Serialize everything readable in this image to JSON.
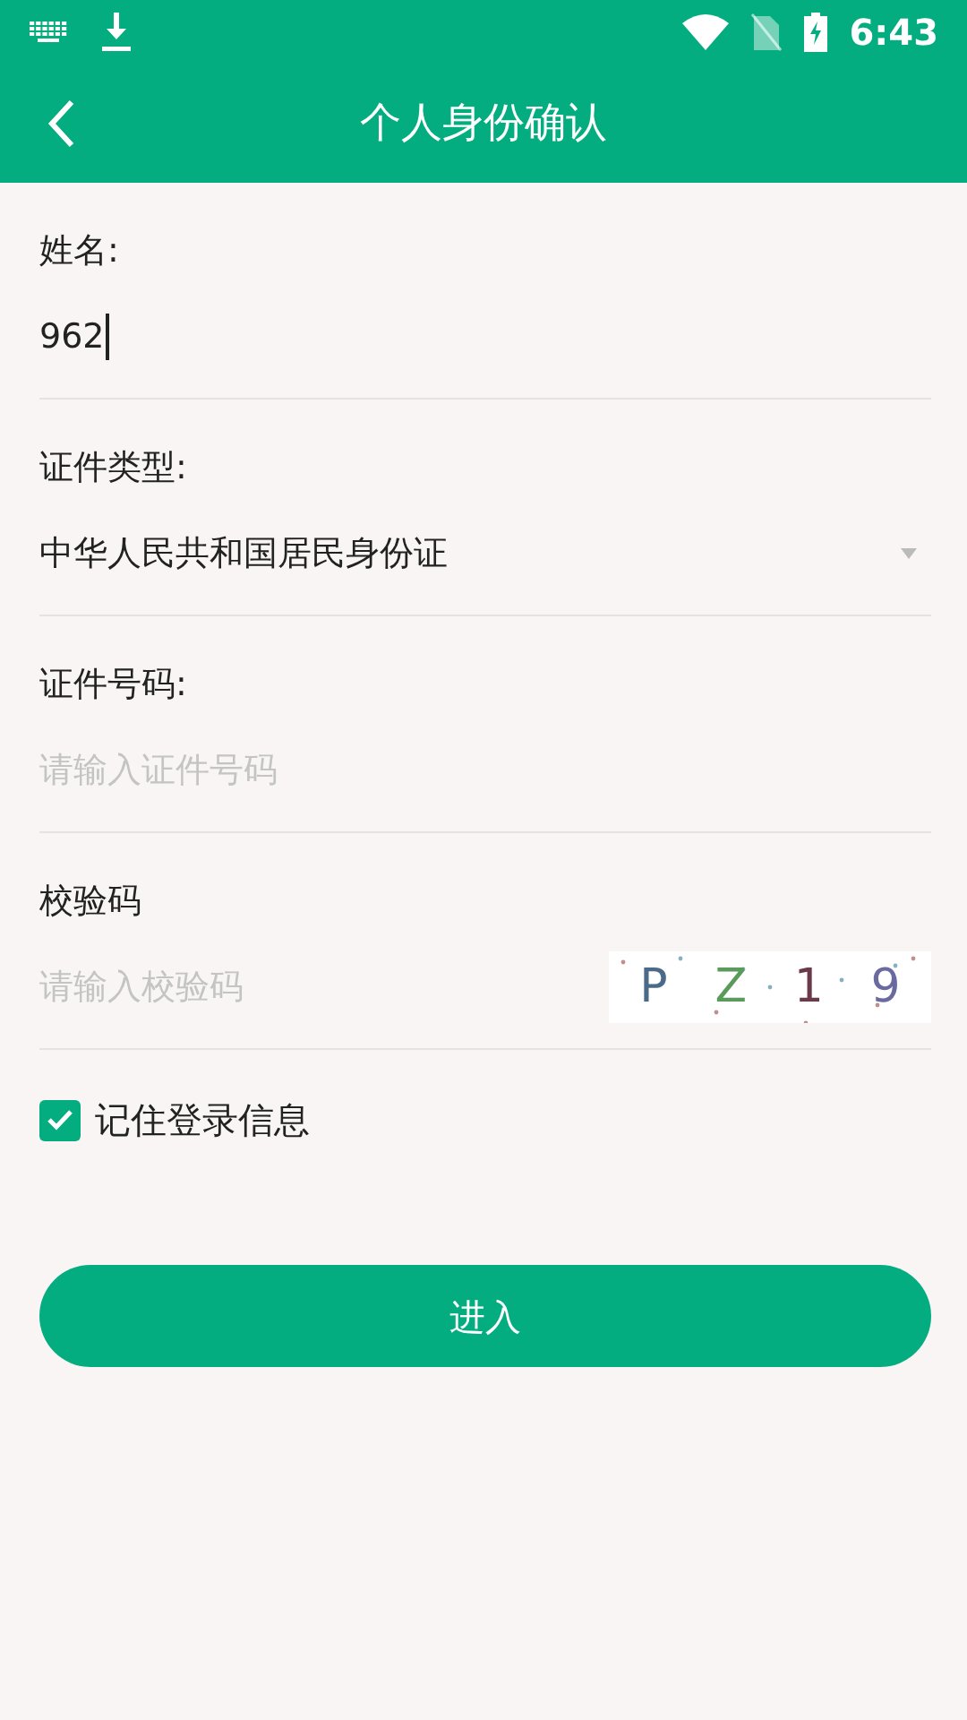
{
  "status_bar": {
    "time": "6:43"
  },
  "header": {
    "title": "个人身份确认"
  },
  "fields": [
    {
      "kind": "text",
      "label": "姓名:",
      "value": "962",
      "focused": true
    },
    {
      "kind": "select",
      "label": "证件类型:",
      "value": "中华人民共和国居民身份证"
    },
    {
      "kind": "text",
      "label": "证件号码:",
      "placeholder": "请输入证件号码",
      "focused": false
    },
    {
      "kind": "captcha",
      "label": "校验码",
      "placeholder": "请输入校验码",
      "captcha": [
        {
          "char": "P",
          "color": "#4a6a8a"
        },
        {
          "char": "Z",
          "color": "#5a9a5a"
        },
        {
          "char": "1",
          "color": "#6a3a4a"
        },
        {
          "char": "9",
          "color": "#6a6aa0"
        }
      ]
    }
  ],
  "remember": {
    "label": "记住登录信息",
    "checked": true
  },
  "submit": {
    "label": "进入"
  }
}
